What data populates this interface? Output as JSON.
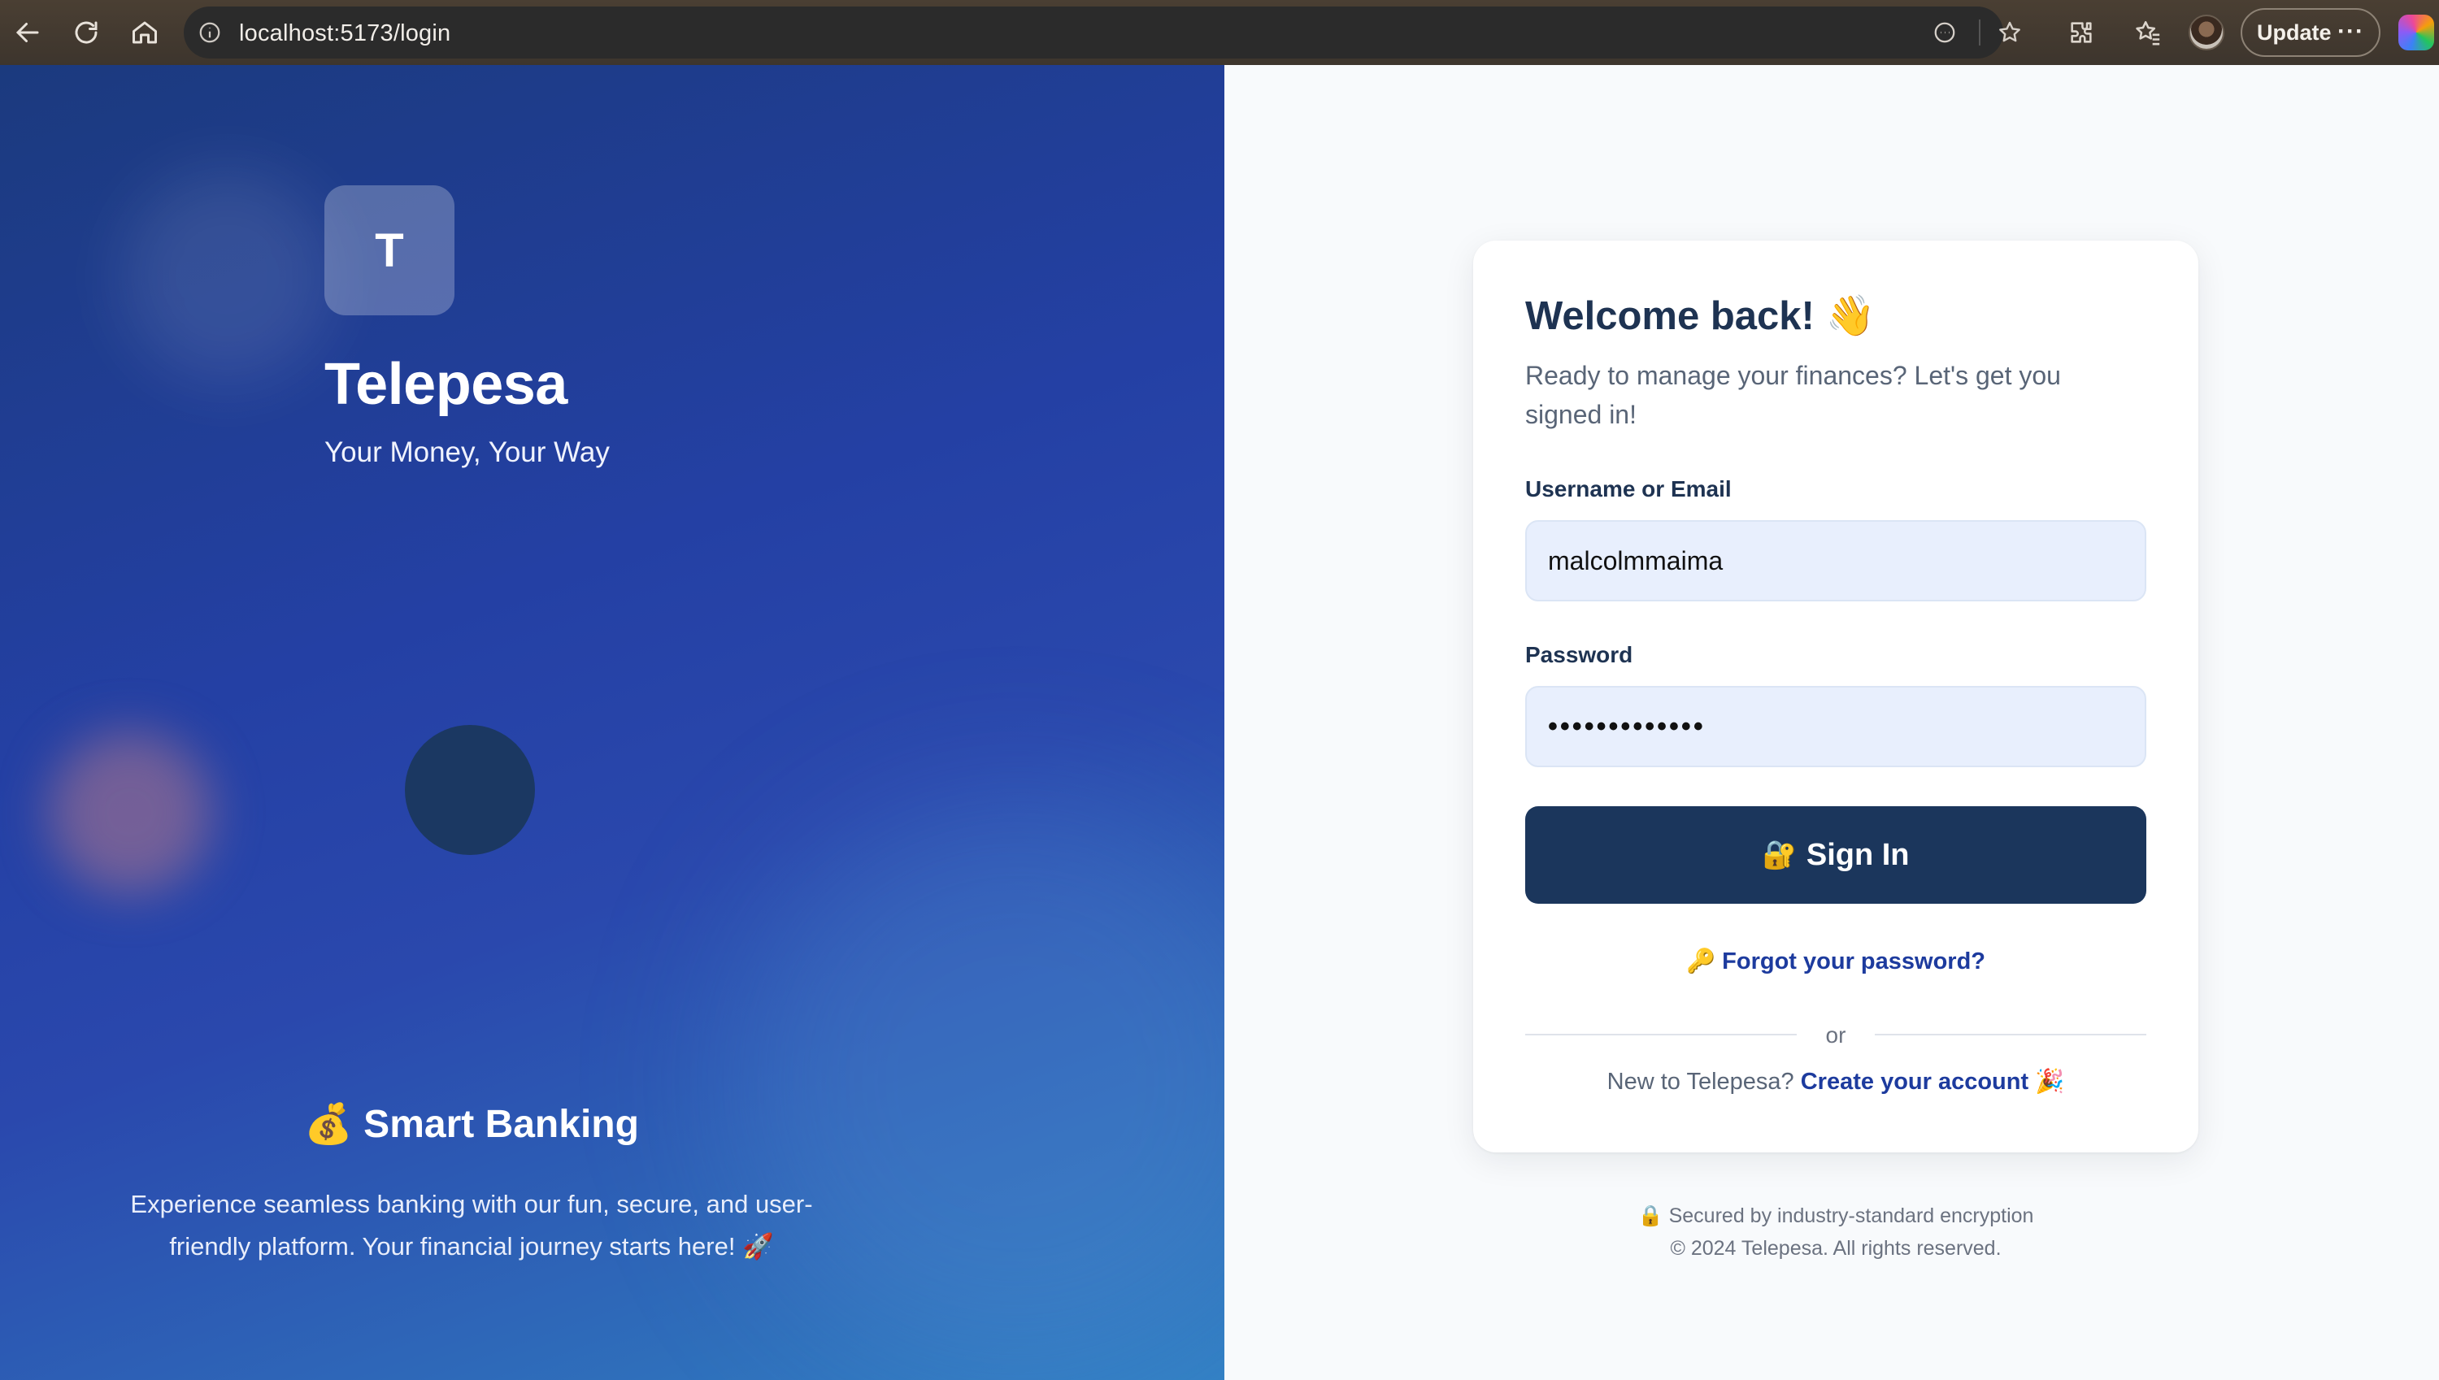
{
  "browser": {
    "url": "localhost:5173/login",
    "update_label": "Update",
    "more_label": "···"
  },
  "hero": {
    "logo_letter": "T",
    "brand_name": "Telepesa",
    "tagline": "Your Money, Your Way",
    "feature_title": "💰 Smart Banking",
    "feature_description": "Experience seamless banking with our fun, secure, and user-friendly platform. Your financial journey starts here! 🚀"
  },
  "login": {
    "title": "Welcome back! 👋",
    "subtitle": "Ready to manage your finances? Let's get you signed in!",
    "username_label": "Username or Email",
    "username_value": "malcolmmaima",
    "password_label": "Password",
    "password_value": "•••••••••••••",
    "signin_emoji": "🔐",
    "signin_label": "Sign In",
    "forgot_emoji": "🔑",
    "forgot_label": "Forgot your password?",
    "divider_label": "or",
    "signup_prompt": "New to Telepesa?",
    "signup_link": "Create your account",
    "signup_emoji": "🎉"
  },
  "footer": {
    "security_note": "🔒 Secured by industry-standard encryption",
    "copyright": "© 2024 Telepesa. All rights reserved."
  },
  "colors": {
    "primary_button": "#1b365c",
    "link": "#1d3b9e",
    "hero_gradient_start": "#1b3a7e",
    "hero_gradient_end": "#3280c4"
  }
}
